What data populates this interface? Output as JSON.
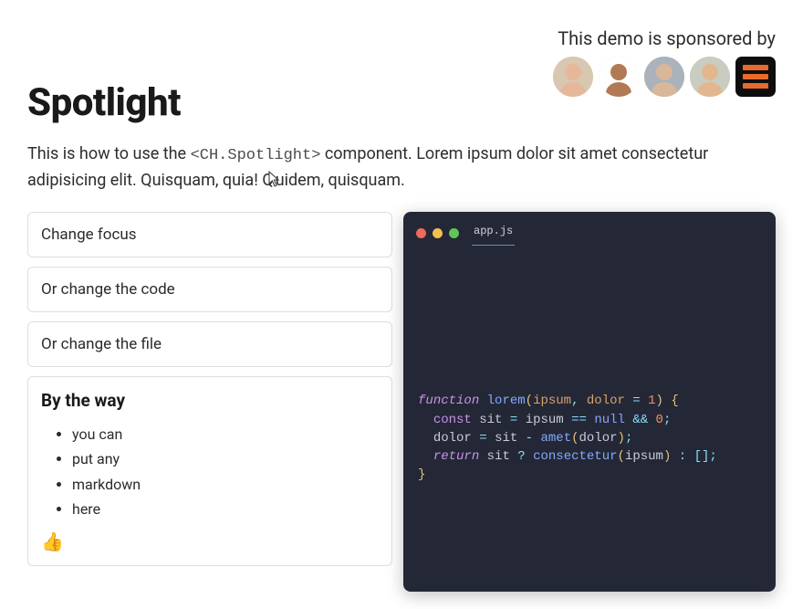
{
  "sponsor": {
    "label": "This demo is sponsored by",
    "avatars": [
      {
        "name": "avatar-1",
        "bg": "#d8c7b1",
        "head": "#e6b89a"
      },
      {
        "name": "avatar-2",
        "bg": "#ffffff",
        "head": "#b27a54"
      },
      {
        "name": "avatar-3",
        "bg": "#aab2bc",
        "head": "#d9b79a"
      },
      {
        "name": "avatar-4",
        "bg": "#c9ccc1",
        "head": "#e2b78f"
      }
    ],
    "logo_name": "sponsor-logo"
  },
  "title": "Spotlight",
  "description": {
    "before_code": "This is how to use the ",
    "code": "<CH.Spotlight>",
    "after_code": " component. Lorem ipsum dolor sit amet consectetur adipisicing elit. Quisquam, quia! Quidem, quisquam."
  },
  "steps": [
    {
      "title": "Change focus"
    },
    {
      "title": "Or change the code"
    },
    {
      "title": "Or change the file"
    }
  ],
  "by_the_way": {
    "heading": "By the way",
    "items": [
      "you can",
      "put any",
      "markdown",
      "here"
    ],
    "emoji": "👍"
  },
  "code_panel": {
    "filename": "app.js",
    "lines": [
      [
        {
          "t": "function",
          "c": "tok-keyword"
        },
        {
          "t": " "
        },
        {
          "t": "lorem",
          "c": "tok-fn"
        },
        {
          "t": "(",
          "c": "tok-punc"
        },
        {
          "t": "ipsum",
          "c": "tok-param"
        },
        {
          "t": ", ",
          "c": "tok-op"
        },
        {
          "t": "dolor",
          "c": "tok-param"
        },
        {
          "t": " = ",
          "c": "tok-op"
        },
        {
          "t": "1",
          "c": "tok-num"
        },
        {
          "t": ")",
          "c": "tok-punc"
        },
        {
          "t": " {",
          "c": "tok-punc"
        }
      ],
      [
        {
          "t": "  "
        },
        {
          "t": "const",
          "c": "tok-kwconst"
        },
        {
          "t": " "
        },
        {
          "t": "sit",
          "c": "tok-var"
        },
        {
          "t": " = ",
          "c": "tok-op"
        },
        {
          "t": "ipsum",
          "c": "tok-var"
        },
        {
          "t": " == ",
          "c": "tok-op"
        },
        {
          "t": "null",
          "c": "tok-bool"
        },
        {
          "t": " && ",
          "c": "tok-op"
        },
        {
          "t": "0",
          "c": "tok-num"
        },
        {
          "t": ";",
          "c": "tok-op"
        }
      ],
      [
        {
          "t": "  "
        },
        {
          "t": "dolor",
          "c": "tok-var"
        },
        {
          "t": " = ",
          "c": "tok-op"
        },
        {
          "t": "sit",
          "c": "tok-var"
        },
        {
          "t": " - ",
          "c": "tok-op"
        },
        {
          "t": "amet",
          "c": "tok-call"
        },
        {
          "t": "(",
          "c": "tok-punc"
        },
        {
          "t": "dolor",
          "c": "tok-var"
        },
        {
          "t": ")",
          "c": "tok-punc"
        },
        {
          "t": ";",
          "c": "tok-op"
        }
      ],
      [
        {
          "t": "  "
        },
        {
          "t": "return",
          "c": "tok-keyword"
        },
        {
          "t": " "
        },
        {
          "t": "sit",
          "c": "tok-var"
        },
        {
          "t": " ? ",
          "c": "tok-op"
        },
        {
          "t": "consectetur",
          "c": "tok-call"
        },
        {
          "t": "(",
          "c": "tok-punc"
        },
        {
          "t": "ipsum",
          "c": "tok-var"
        },
        {
          "t": ")",
          "c": "tok-punc"
        },
        {
          "t": " : ",
          "c": "tok-op"
        },
        {
          "t": "[]",
          "c": "tok-bracket"
        },
        {
          "t": ";",
          "c": "tok-op"
        }
      ],
      [
        {
          "t": "}",
          "c": "tok-punc"
        }
      ]
    ]
  }
}
